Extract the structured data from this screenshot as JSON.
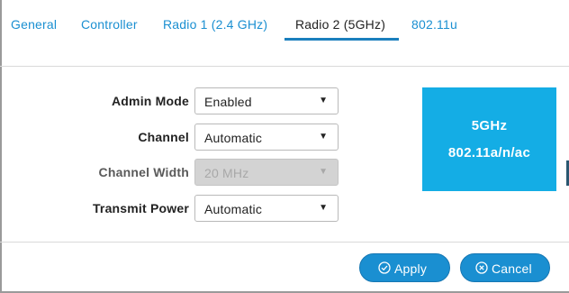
{
  "tabs": [
    {
      "label": "General"
    },
    {
      "label": "Controller"
    },
    {
      "label": "Radio 1 (2.4 GHz)"
    },
    {
      "label": "Radio 2 (5GHz)",
      "active": true
    },
    {
      "label": "802.11u"
    }
  ],
  "form": {
    "admin_mode": {
      "label": "Admin Mode",
      "value": "Enabled"
    },
    "channel": {
      "label": "Channel",
      "value": "Automatic"
    },
    "channel_width": {
      "label": "Channel Width",
      "value": "20 MHz",
      "disabled": true
    },
    "transmit_power": {
      "label": "Transmit Power",
      "value": "Automatic"
    }
  },
  "badge": {
    "band": "5GHz",
    "standard": "802.11a/n/ac",
    "color": "#14ade5"
  },
  "actions": {
    "apply_label": "Apply",
    "apply_icon": "check-circle-icon",
    "cancel_label": "Cancel",
    "cancel_icon": "x-circle-icon"
  },
  "colors": {
    "accent": "#1a8fd1",
    "active_tab_underline": "#1a7fbd"
  }
}
